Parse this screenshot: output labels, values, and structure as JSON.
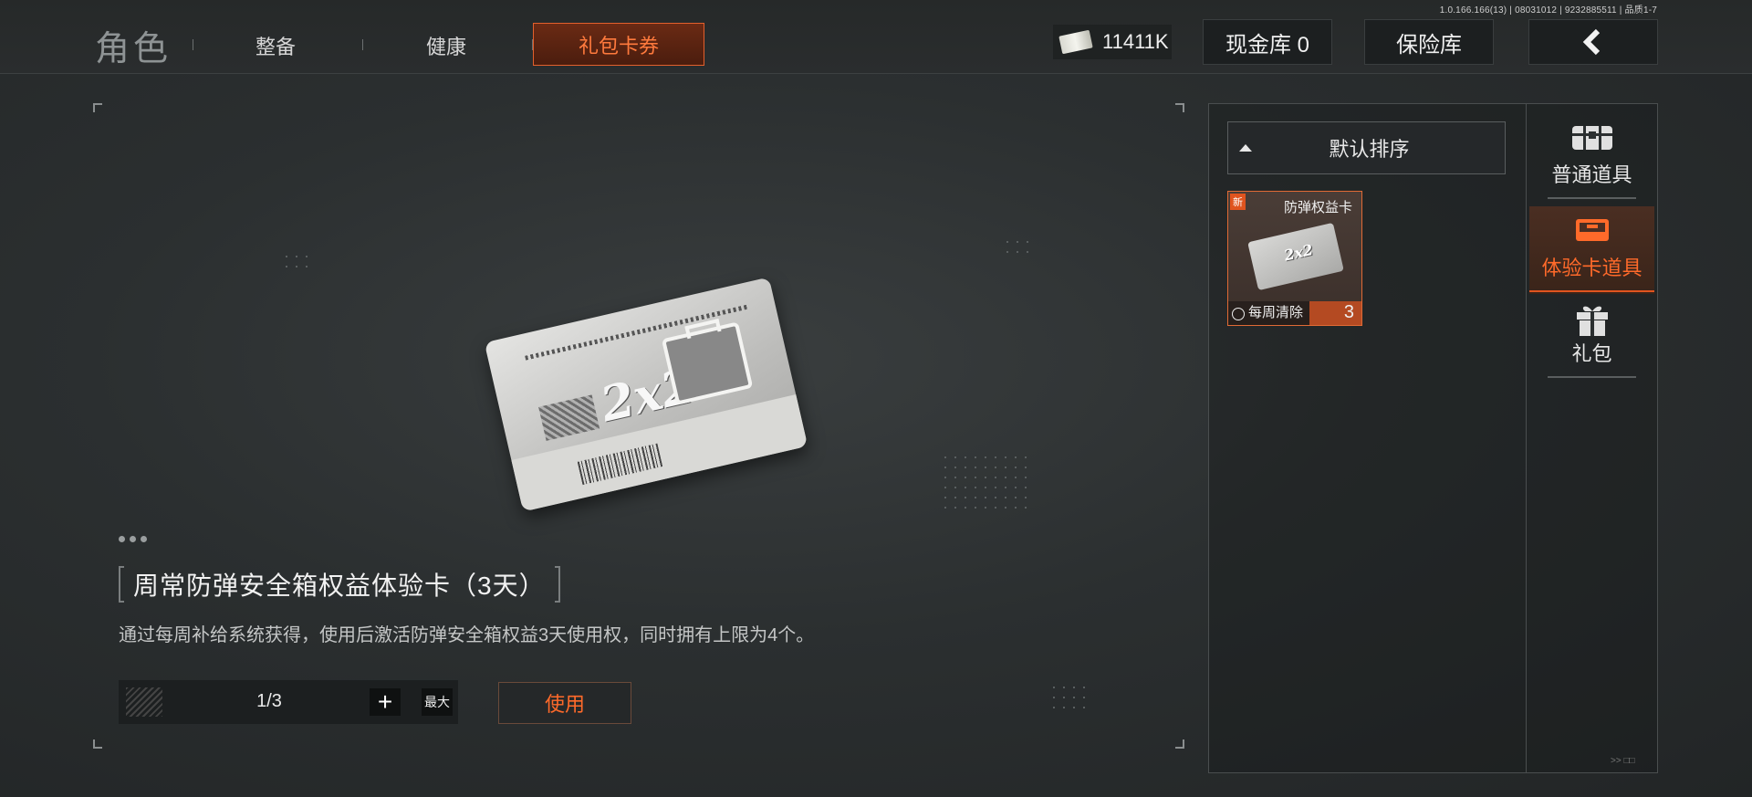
{
  "version_text": "1.0.166.166(13) | 08031012 | 9232885511 | 品质1-7",
  "nav": {
    "role": "角色",
    "tabs": [
      "整备",
      "健康"
    ],
    "active_tab": "礼包卡券"
  },
  "currency": {
    "icon": "cash-bundle-icon",
    "amount": "11411K"
  },
  "top_buttons": {
    "cash_vault": "现金库 0",
    "safe_box": "保险库",
    "back_icon": "chevron-left-icon"
  },
  "detail": {
    "card_art": "2x2",
    "title": "周常防弹安全箱权益体验卡（3天）",
    "description": "通过每周补给系统获得，使用后激活防弹安全箱权益3天使用权，同时拥有上限为4个。",
    "quantity": "1/3",
    "plus_label": "+",
    "max_label": "最大",
    "use_label": "使用"
  },
  "inventory": {
    "sort_label": "默认排序",
    "items": [
      {
        "badge": "新",
        "name": "防弹权益卡",
        "tag": "每周清除",
        "count": "3",
        "card_art": "2x2"
      }
    ],
    "footer": ">> □□"
  },
  "categories": [
    {
      "label": "普通道具",
      "icon": "chest-icon",
      "active": false
    },
    {
      "label": "体验卡道具",
      "icon": "case-card-icon",
      "active": true
    },
    {
      "label": "礼包",
      "icon": "gift-icon",
      "active": false
    }
  ],
  "colors": {
    "accent": "#ff6a2a",
    "accent_border": "#e3602c",
    "background": "#2b2f30"
  }
}
